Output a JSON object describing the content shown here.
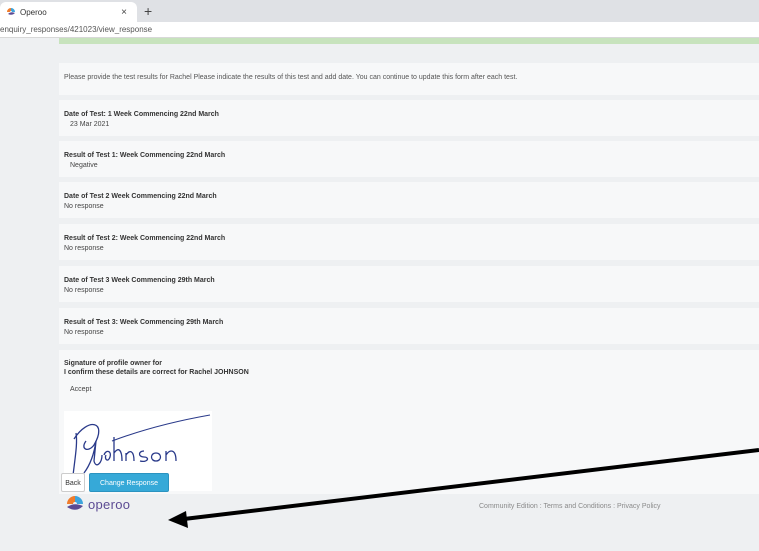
{
  "browser": {
    "tab_title": "Operoo",
    "tab_close": "×",
    "new_tab": "+",
    "url": "enquiry_responses/421023/view_response"
  },
  "form": {
    "intro": "Please provide the test results for Rachel Please indicate the results of this test and add date. You can continue to update this form after each test.",
    "questions": [
      {
        "label": "Date of Test: 1 Week Commencing 22nd March",
        "answer": "23 Mar 2021"
      },
      {
        "label": "Result of Test 1: Week Commencing 22nd March",
        "answer": "Negative"
      },
      {
        "label": "Date of Test 2 Week Commencing 22nd March",
        "answer": "No response"
      },
      {
        "label": "Result of Test 2: Week Commencing 22nd March",
        "answer": "No response"
      },
      {
        "label": "Date of Test 3 Week Commencing 29th March",
        "answer": "No response"
      },
      {
        "label": "Result of Test 3: Week Commencing 29th March",
        "answer": "No response"
      }
    ],
    "signature": {
      "label_line1": "Signature of profile owner for",
      "label_line2": "I confirm these details are correct for Rachel JOHNSON",
      "answer": "Accept",
      "signature_text": "RJohnson"
    }
  },
  "actions": {
    "back_label": "Back",
    "change_label": "Change Response"
  },
  "brand": {
    "logo_text": "operoo",
    "accent_color": "#36a9d8",
    "logo_color": "#5b4a93"
  },
  "footer": {
    "text": "Community Edition : Terms and Conditions : Privacy Policy"
  }
}
